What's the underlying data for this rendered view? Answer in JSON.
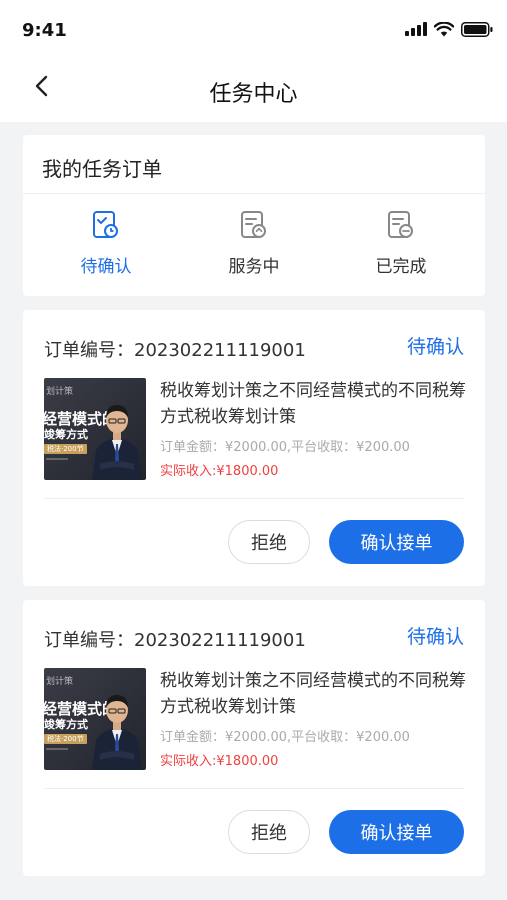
{
  "status_bar": {
    "time": "9:41"
  },
  "nav": {
    "title": "任务中心"
  },
  "summary": {
    "title": "我的任务订单",
    "tabs": [
      {
        "label": "待确认",
        "icon": "pending-doc-icon"
      },
      {
        "label": "服务中",
        "icon": "in-service-doc-icon"
      },
      {
        "label": "已完成",
        "icon": "completed-doc-icon"
      }
    ]
  },
  "orders": [
    {
      "order_no": "订单编号：202302211119001",
      "status": "待确认",
      "thumb": {
        "line1": "划计策",
        "line2": "经营模式的",
        "line3": "竣筹方式",
        "tag": "税法·200节"
      },
      "title": "税收筹划计策之不同经营模式的不同税筹方式税收筹划计策",
      "amount": "订单金额：¥2000.00,平台收取：¥200.00",
      "income": "实际收入:¥1800.00",
      "reject_label": "拒绝",
      "accept_label": "确认接单"
    },
    {
      "order_no": "订单编号：202302211119001",
      "status": "待确认",
      "thumb": {
        "line1": "划计策",
        "line2": "经营模式的",
        "line3": "竣筹方式",
        "tag": "税法·200节"
      },
      "title": "税收筹划计策之不同经营模式的不同税筹方式税收筹划计策",
      "amount": "订单金额：¥2000.00,平台收取：¥200.00",
      "income": "实际收入:¥1800.00",
      "reject_label": "拒绝",
      "accept_label": "确认接单"
    }
  ],
  "colors": {
    "accent": "#1d6fe8",
    "income": "#f04141",
    "background": "#f2f3f5"
  }
}
